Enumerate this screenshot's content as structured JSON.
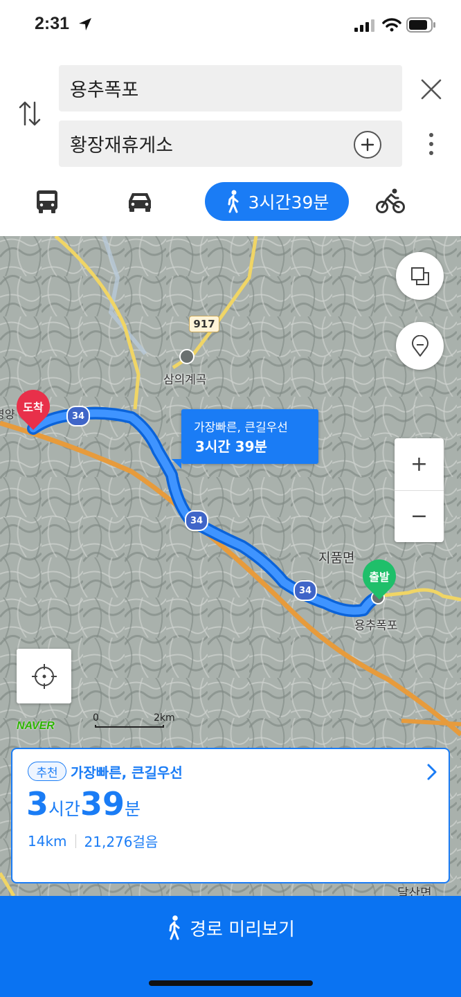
{
  "status_bar": {
    "time": "2:31"
  },
  "search": {
    "origin": "용추폭포",
    "destination": "황장재휴게소"
  },
  "modes": {
    "walk_label": "3시간39분"
  },
  "map": {
    "road_badge_917": "917",
    "road_badge_34": "34",
    "place_samui": "삼의계곡",
    "place_jipum": "지품면",
    "place_yongchu": "용추폭포",
    "place_dalsan": "달산면",
    "place_left_cut": "영양",
    "arrival_pin": "도착",
    "departure_pin": "출발",
    "callout_line1": "가장빠른, 큰길우선",
    "callout_line2": "3시간 39분",
    "zoom_in": "+",
    "zoom_out": "−",
    "logo": "NAVER",
    "scale_zero": "0",
    "scale_dist": "2km"
  },
  "route_card": {
    "badge": "추천",
    "name": "가장빠른, 큰길우선",
    "hours": "3",
    "hours_unit": "시간",
    "minutes": "39",
    "minutes_unit": "분",
    "distance": "14km",
    "steps": "21,276걸음"
  },
  "footer": {
    "preview_label": "경로 미리보기"
  },
  "colors": {
    "accent": "#1a7cf5",
    "bottom_bar": "#0a73f2",
    "arrival_pin": "#e8304a",
    "departure_pin": "#1fbf6a"
  }
}
